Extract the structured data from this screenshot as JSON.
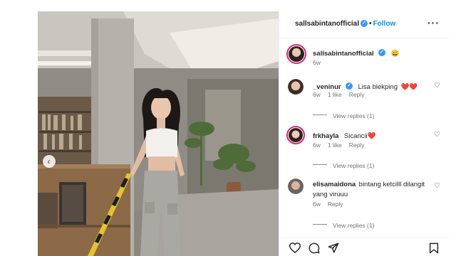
{
  "post": {
    "author": "sallsabintanofficial",
    "follow_label": "Follow",
    "caption_emoji": "😄",
    "caption_time": "6w"
  },
  "comments": [
    {
      "user": "_veninur",
      "text": "Lisa blekping",
      "emoji": "❤️❤️",
      "time": "6w",
      "likes": "1 like",
      "reply": "Reply",
      "view_replies": "View replies (1)"
    },
    {
      "user": "frkhayla",
      "text": "Sicancii",
      "emoji": "❤️",
      "time": "6w",
      "likes": "1 like",
      "reply": "Reply",
      "view_replies": "View replies (1)"
    },
    {
      "user": "elisamaidona",
      "text": "bintang ketcilll dilangit yang viruuu",
      "time": "6w",
      "reply": "Reply",
      "view_replies": "View replies (1)"
    }
  ],
  "icons": {
    "verified": "verified-badge-icon",
    "more": "more-options-icon",
    "like": "heart-icon",
    "comment": "comment-icon",
    "share": "share-icon",
    "save": "bookmark-icon",
    "prev": "chevron-left-icon"
  },
  "colors": {
    "accent": "#0095f6",
    "verified": "#3897f0",
    "heart_red": "#ed4956"
  }
}
